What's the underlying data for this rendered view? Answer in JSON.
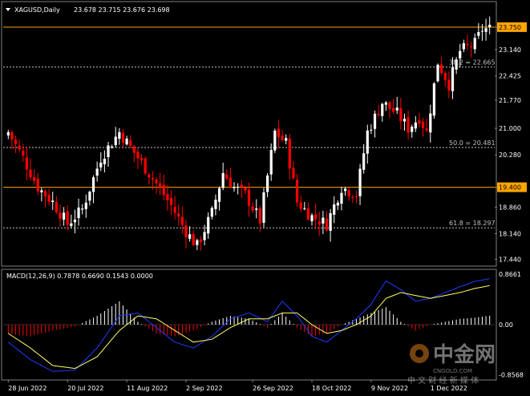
{
  "header": {
    "symbol": "XAGUSD,Daily",
    "ohlc": "23.678 23.715 23.676 23.698"
  },
  "macd_header": {
    "label": "MACD(12,26,9) 0.7878 0.6690 0.1543 0.0000"
  },
  "watermark": {
    "brand": "中金网",
    "sub": "中 文 财 经 新 媒 体",
    "site": "CNGOLD.COM"
  },
  "colors": {
    "background": "#000000",
    "bull": "#ffffff",
    "bear": "#ff0000",
    "level_line": "#ffa500",
    "fib_line": "#c0c0c0",
    "macd_line": "#1e3cff",
    "signal_line": "#ffff66",
    "axis_text": "#ffffff"
  },
  "chart_data": [
    {
      "type": "candlestick",
      "title": "XAGUSD,Daily",
      "price_ticks": [
        "23.750",
        "23.140",
        "22.425",
        "21.770",
        "21.000",
        "20.280",
        "19.400",
        "18.860",
        "18.140",
        "17.440"
      ],
      "ylim": [
        17.3,
        24.4
      ],
      "x_ticks": [
        "28 Jun 2022",
        "20 Jul 2022",
        "11 Aug 2022",
        "2 Sep 2022",
        "26 Sep 2022",
        "18 Oct 2022",
        "9 Nov 2022",
        "1 Dec 2022"
      ],
      "x_tick_index": [
        0,
        16,
        32,
        48,
        66,
        82,
        98,
        114
      ],
      "levels": [
        {
          "label": "23.750",
          "value": 23.75,
          "style": "solid",
          "highlight": true
        },
        {
          "label": "19.400",
          "value": 19.4,
          "style": "solid",
          "highlight": true
        }
      ],
      "fib_levels": [
        {
          "label": "38.2 = 22.665",
          "value": 22.665
        },
        {
          "label": "50.0 = 20.481",
          "value": 20.481
        },
        {
          "label": "61.8 = 18.297",
          "value": 18.297
        }
      ],
      "candles_count": 131,
      "close_path": [
        [
          0,
          20.9
        ],
        [
          4,
          20.2
        ],
        [
          8,
          19.4
        ],
        [
          12,
          19.0
        ],
        [
          16,
          18.4
        ],
        [
          20,
          18.8
        ],
        [
          25,
          20.2
        ],
        [
          30,
          20.9
        ],
        [
          35,
          20.2
        ],
        [
          40,
          19.5
        ],
        [
          44,
          18.9
        ],
        [
          48,
          18.2
        ],
        [
          51,
          17.8
        ],
        [
          55,
          18.7
        ],
        [
          58,
          19.8
        ],
        [
          61,
          19.4
        ],
        [
          64,
          19.2
        ],
        [
          68,
          18.5
        ],
        [
          72,
          20.9
        ],
        [
          75,
          20.6
        ],
        [
          78,
          19.0
        ],
        [
          82,
          18.6
        ],
        [
          86,
          18.4
        ],
        [
          90,
          19.4
        ],
        [
          94,
          19.2
        ],
        [
          97,
          20.9
        ],
        [
          101,
          21.7
        ],
        [
          105,
          21.4
        ],
        [
          108,
          21.0
        ],
        [
          111,
          21.3
        ],
        [
          113,
          20.9
        ],
        [
          116,
          22.8
        ],
        [
          119,
          22.2
        ],
        [
          122,
          23.1
        ],
        [
          126,
          23.3
        ],
        [
          128,
          23.7
        ],
        [
          130,
          23.698
        ]
      ]
    },
    {
      "type": "line",
      "title": "MACD(12,26,9)",
      "price_ticks": [
        "0.8661",
        "0.00",
        "-0.8568"
      ],
      "ylim": [
        -0.92,
        0.92
      ],
      "series": [
        {
          "name": "MACD",
          "x": [
            0,
            6,
            12,
            18,
            24,
            30,
            35,
            40,
            45,
            50,
            55,
            60,
            65,
            70,
            74,
            78,
            82,
            86,
            90,
            94,
            98,
            102,
            106,
            110,
            114,
            118,
            122,
            126,
            130
          ],
          "values": [
            -0.3,
            -0.6,
            -0.8,
            -0.78,
            -0.4,
            0.15,
            0.2,
            -0.05,
            -0.3,
            -0.4,
            -0.2,
            0.1,
            0.2,
            0.05,
            0.4,
            0.15,
            -0.2,
            -0.3,
            -0.1,
            0.1,
            0.35,
            0.75,
            0.6,
            0.4,
            0.45,
            0.55,
            0.65,
            0.74,
            0.7878
          ]
        },
        {
          "name": "Signal",
          "x": [
            0,
            6,
            12,
            18,
            24,
            30,
            35,
            40,
            45,
            50,
            55,
            60,
            65,
            70,
            74,
            78,
            82,
            86,
            90,
            94,
            98,
            102,
            106,
            110,
            114,
            118,
            122,
            126,
            130
          ],
          "values": [
            -0.15,
            -0.4,
            -0.7,
            -0.75,
            -0.55,
            -0.1,
            0.15,
            0.1,
            -0.1,
            -0.3,
            -0.25,
            -0.05,
            0.1,
            0.1,
            0.2,
            0.2,
            0.0,
            -0.15,
            -0.1,
            0.0,
            0.15,
            0.45,
            0.55,
            0.5,
            0.45,
            0.5,
            0.55,
            0.62,
            0.669
          ]
        },
        {
          "name": "Histogram",
          "x": [
            0,
            6,
            12,
            18,
            24,
            30,
            35,
            40,
            45,
            50,
            55,
            60,
            65,
            70,
            74,
            78,
            82,
            86,
            90,
            94,
            98,
            102,
            106,
            110,
            114,
            118,
            122,
            126,
            130
          ],
          "values": [
            -0.15,
            -0.2,
            -0.1,
            -0.03,
            0.15,
            0.4,
            0.05,
            -0.15,
            -0.2,
            -0.1,
            0.05,
            0.15,
            0.1,
            -0.05,
            0.2,
            -0.05,
            -0.2,
            -0.15,
            0.0,
            0.1,
            0.2,
            0.3,
            0.05,
            -0.1,
            0.0,
            0.05,
            0.1,
            0.12,
            0.1543
          ]
        }
      ]
    }
  ]
}
